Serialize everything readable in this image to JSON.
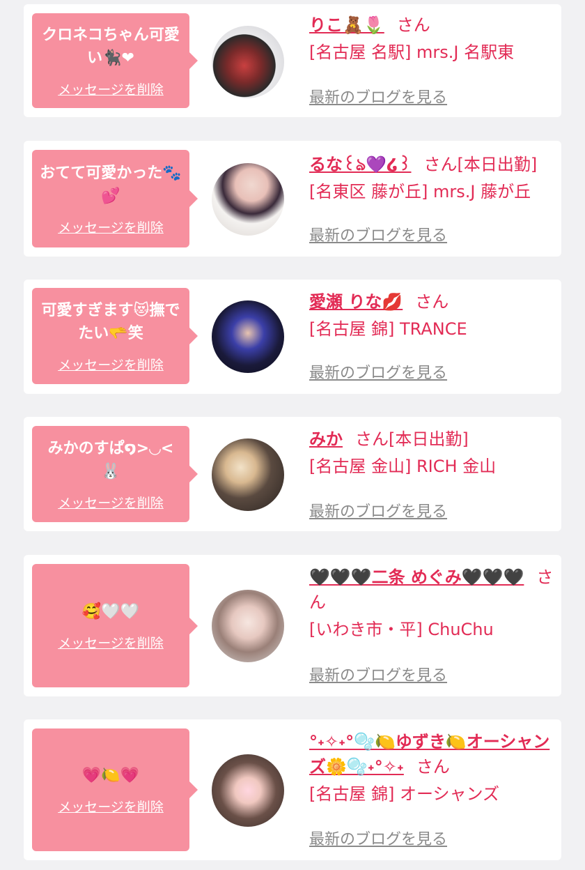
{
  "cards": [
    {
      "message": "クロネコちゃん可愛い🐈‍⬛❤",
      "delete_label": "メッセージを削除",
      "name": "りこ🧸🌷",
      "suffix": "さん",
      "status": "",
      "shop": "[名古屋 名駅] mrs.J 名駅東",
      "blog_label": "最新のブログを見る"
    },
    {
      "message": "おてて可愛かった🐾💕",
      "delete_label": "メッセージを削除",
      "name": "るな꒰ঌ💜໒꒱",
      "suffix": "さん",
      "status": "[本日出勤]",
      "shop": "[名東区 藤が丘] mrs.J 藤が丘",
      "blog_label": "最新のブログを見る"
    },
    {
      "message": "可愛すぎます😻撫でたい🫳笑",
      "delete_label": "メッセージを削除",
      "name": "愛瀬 りな💋",
      "suffix": "さん",
      "status": "",
      "shop": "[名古屋 錦] TRANCE",
      "blog_label": "最新のブログを見る"
    },
    {
      "message": "みかのすぱ໑>◡<🐰",
      "delete_label": "メッセージを削除",
      "name": "みか",
      "suffix": "さん",
      "status": "[本日出勤]",
      "shop": "[名古屋 金山] RICH 金山",
      "blog_label": "最新のブログを見る"
    },
    {
      "message": "🥰🤍🤍",
      "delete_label": "メッセージを削除",
      "name": "🖤🖤🖤二条 めぐみ🖤🖤🖤",
      "suffix": "さん",
      "status": "",
      "shop": "[いわき市・平] ChuChu",
      "blog_label": "最新のブログを見る"
    },
    {
      "message": "💗🍋💗",
      "delete_label": "メッセージを削除",
      "name": "°˖✧˖°🫧🍋ゆずき🍋オーシャンズ🌼🫧˖°✧˖",
      "suffix": "さん",
      "status": "",
      "shop": "[名古屋 錦] オーシャンズ",
      "blog_label": "最新のブログを見る"
    }
  ],
  "colors": {
    "accent": "#e22b55",
    "bubble": "#f7909f",
    "link_gray": "#8a8a8a",
    "background": "#f1f1f3"
  }
}
